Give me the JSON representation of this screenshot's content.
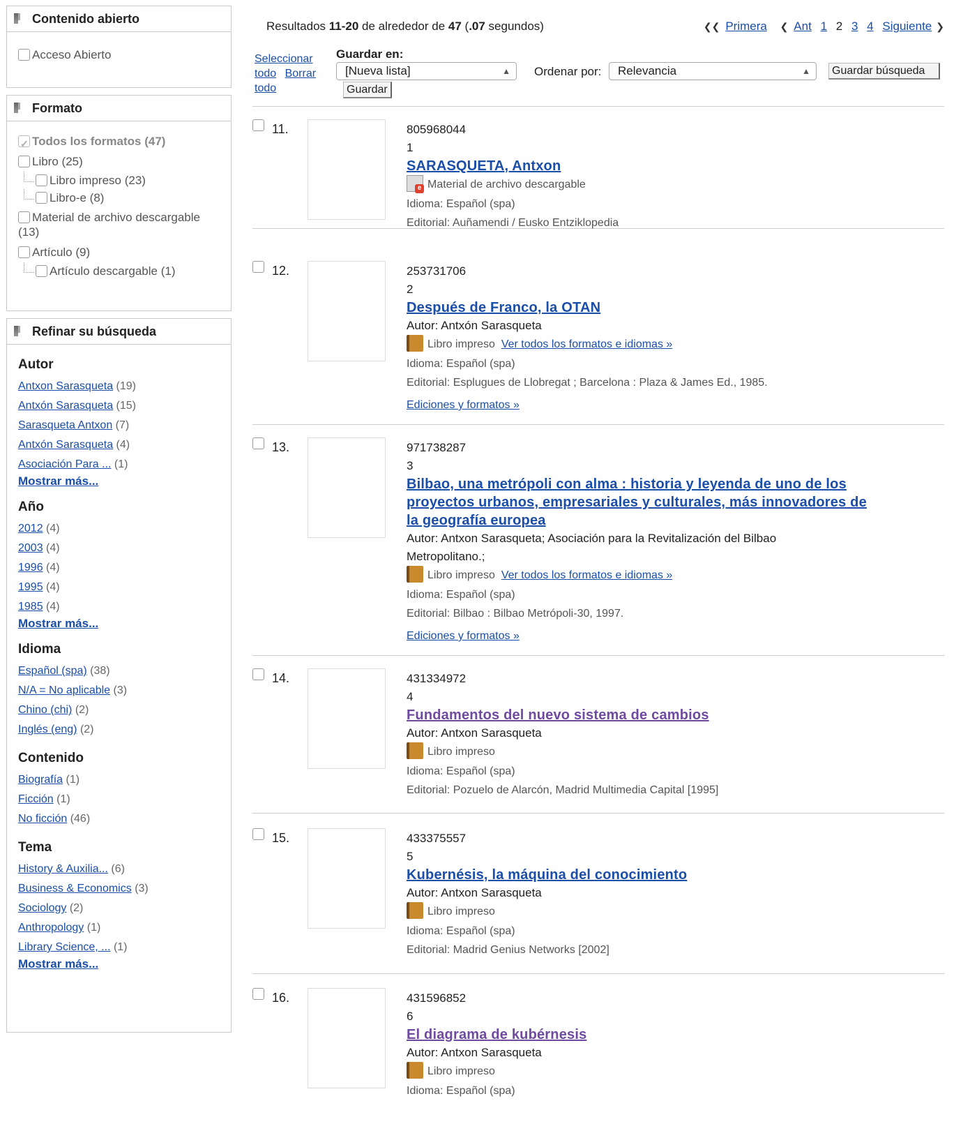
{
  "sidebar": {
    "open": {
      "title": "Contenido abierto",
      "item": "Acceso Abierto"
    },
    "format": {
      "title": "Formato",
      "all": "Todos los formatos",
      "all_count": "(47)",
      "items": [
        {
          "label": "Libro",
          "count": "(25)"
        },
        {
          "label": "Libro impreso",
          "count": "(23)"
        },
        {
          "label": "Libro-e",
          "count": "(8)"
        },
        {
          "label": "Material de archivo descargable",
          "count": "(13)"
        },
        {
          "label": "Artículo",
          "count": "(9)"
        },
        {
          "label": "Artículo descargable",
          "count": "(1)"
        }
      ]
    },
    "refine": {
      "title": "Refinar su búsqueda",
      "more": "Mostrar más...",
      "author": {
        "title": "Autor",
        "items": [
          {
            "label": "Antxon Sarasqueta",
            "count": "(19)"
          },
          {
            "label": "Antxón Sarasqueta",
            "count": "(15)"
          },
          {
            "label": "Sarasqueta Antxon",
            "count": "(7)"
          },
          {
            "label": "Antxón Sarasqueta",
            "count": "(4)"
          },
          {
            "label": "Asociación Para ...",
            "count": "(1)"
          }
        ]
      },
      "year": {
        "title": "Año",
        "items": [
          {
            "label": "2012",
            "count": "(4)"
          },
          {
            "label": "2003",
            "count": "(4)"
          },
          {
            "label": "1996",
            "count": "(4)"
          },
          {
            "label": "1995",
            "count": "(4)"
          },
          {
            "label": "1985",
            "count": "(4)"
          }
        ]
      },
      "language": {
        "title": "Idioma",
        "items": [
          {
            "label": "Español (spa)",
            "count": "(38)"
          },
          {
            "label": "N/A = No aplicable",
            "count": "(3)"
          },
          {
            "label": "Chino (chi)",
            "count": "(2)"
          },
          {
            "label": "Inglés (eng)",
            "count": "(2)"
          }
        ]
      },
      "content": {
        "title": "Contenido",
        "items": [
          {
            "label": "Biografía",
            "count": "(1)"
          },
          {
            "label": "Ficción",
            "count": "(1)"
          },
          {
            "label": "No ficción",
            "count": "(46)"
          }
        ]
      },
      "topic": {
        "title": "Tema",
        "items": [
          {
            "label": "History & Auxilia...",
            "count": "(6)"
          },
          {
            "label": "Business & Economics",
            "count": "(3)"
          },
          {
            "label": "Sociology",
            "count": "(2)"
          },
          {
            "label": "Anthropology",
            "count": "(1)"
          },
          {
            "label": "Library Science, ...",
            "count": "(1)"
          }
        ]
      }
    }
  },
  "summary": {
    "prefix": "Resultados ",
    "range": "11-20",
    "mid": " de alrededor de ",
    "total": "47",
    "open": " (",
    "time": ".07",
    "suffix": " segundos)"
  },
  "pager": {
    "first": "Primera",
    "prev": "Ant",
    "p1": "1",
    "p2": "2",
    "p3": "3",
    "p4": "4",
    "next": "Siguiente"
  },
  "toolbar": {
    "select": "Seleccionar",
    "all": "todo",
    "clear": "Borrar",
    "clear_all": "todo",
    "save_in": "Guardar en:",
    "list_value": "[Nueva lista]",
    "save": "Guardar",
    "sort_label": "Ordenar por:",
    "sort_value": "Relevancia",
    "save_search": "Guardar búsqueda"
  },
  "labels": {
    "editions": "Ediciones y formatos »",
    "all_formats": "Ver todos los formatos e idiomas »"
  },
  "results": [
    {
      "num": "11.",
      "id": "805968044",
      "rank": "1",
      "title": "SARASQUETA, Antxon",
      "format": "Material de archivo descargable",
      "lang": "Idioma: Español (spa)",
      "publisher": "Editorial: Auñamendi / Eusko Entziklopedia"
    },
    {
      "num": "12.",
      "id": "253731706",
      "rank": "2",
      "title": "Después de Franco, la OTAN",
      "author": "Autor: Antxón Sarasqueta",
      "format": "Libro impreso",
      "lang": "Idioma: Español (spa)",
      "publisher": "Editorial: Esplugues de Llobregat ; Barcelona : Plaza & James Ed., 1985."
    },
    {
      "num": "13.",
      "id": "971738287",
      "rank": "3",
      "title1": "Bilbao, una metrópoli con alma : historia y leyenda de uno de los",
      "title2": "proyectos urbanos, empresariales y culturales, más innovadores de",
      "title3": "la geografía europea",
      "author1": "Autor: Antxon Sarasqueta; Asociación para la Revitalización del Bilbao",
      "author2": "Metropolitano.;",
      "format": "Libro impreso",
      "lang": "Idioma: Español (spa)",
      "publisher": "Editorial: Bilbao : Bilbao Metrópoli-30, 1997."
    },
    {
      "num": "14.",
      "id": "431334972",
      "rank": "4",
      "title": "Fundamentos del nuevo sistema de cambios",
      "author": "Autor: Antxon Sarasqueta",
      "format": "Libro impreso",
      "lang": "Idioma: Español (spa)",
      "publisher": "Editorial: Pozuelo de Alarcón, Madrid Multimedia Capital [1995]"
    },
    {
      "num": "15.",
      "id": "433375557",
      "rank": "5",
      "title": "Kubernésis, la máquina del conocimiento",
      "author": "Autor: Antxon Sarasqueta",
      "format": "Libro impreso",
      "lang": "Idioma: Español (spa)",
      "publisher": "Editorial: Madrid Genius Networks [2002]"
    },
    {
      "num": "16.",
      "id": "431596852",
      "rank": "6",
      "title": "El diagrama de kubérnesis",
      "author": "Autor: Antxon Sarasqueta",
      "format": "Libro impreso",
      "lang": "Idioma: Español (spa)"
    }
  ]
}
